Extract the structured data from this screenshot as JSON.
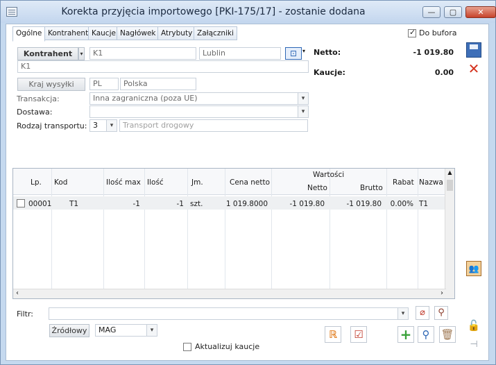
{
  "window": {
    "title": "Korekta przyjęcia importowego [PKI-175/17]  - zostanie dodana",
    "minimize": "—",
    "maximize": "▢",
    "close": "✕"
  },
  "tabs": [
    "Ogólne",
    "Kontrahent",
    "Kaucje",
    "Nagłówek",
    "Atrybuty",
    "Załączniki"
  ],
  "do_bufora": {
    "label": "Do bufora",
    "checked": true
  },
  "kontrahent": {
    "button": "Kontrahent",
    "code": "K1",
    "city": "Lublin",
    "name": "K1"
  },
  "kraj": {
    "button": "Kraj wysyłki",
    "code": "PL",
    "name": "Polska"
  },
  "transakcja": {
    "label": "Transakcja:",
    "value": "Inna zagraniczna (poza UE)"
  },
  "dostawa": {
    "label": "Dostawa:",
    "value": ""
  },
  "transport": {
    "label": "Rodzaj transportu:",
    "code": "3",
    "placeholder": "Transport drogowy"
  },
  "summary": {
    "netto_label": "Netto:",
    "netto_value": "-1 019.80",
    "kaucje_label": "Kaucje:",
    "kaucje_value": "0.00"
  },
  "grid": {
    "headers": {
      "lp": "Lp.",
      "kod": "Kod",
      "ilosc_max": "Ilość max",
      "ilosc": "Ilość",
      "jm": "Jm.",
      "cena": "Cena netto",
      "wartosci": "Wartości",
      "netto": "Netto",
      "brutto": "Brutto",
      "rabat": "Rabat",
      "nazwa": "Nazwa"
    },
    "rows": [
      {
        "lp": "00001",
        "kod": "T1",
        "ilosc_max": "-1",
        "ilosc": "-1",
        "jm": "szt.",
        "cena": "1 019.8000",
        "netto": "-1 019.80",
        "brutto": "-1 019.80",
        "rabat": "0.00%",
        "nazwa": "T1"
      }
    ]
  },
  "filter": {
    "label": "Filtr:",
    "value": ""
  },
  "zrodlowy": {
    "button": "Źródłowy",
    "value": "MAG"
  },
  "aktualizuj": {
    "label": "Aktualizuj kaucje",
    "checked": false
  },
  "colors": {
    "title_bg": "#c5d9ef",
    "close_red": "#c7432c",
    "accent_blue": "#2d66b5",
    "plus_green": "#3aa23a"
  }
}
